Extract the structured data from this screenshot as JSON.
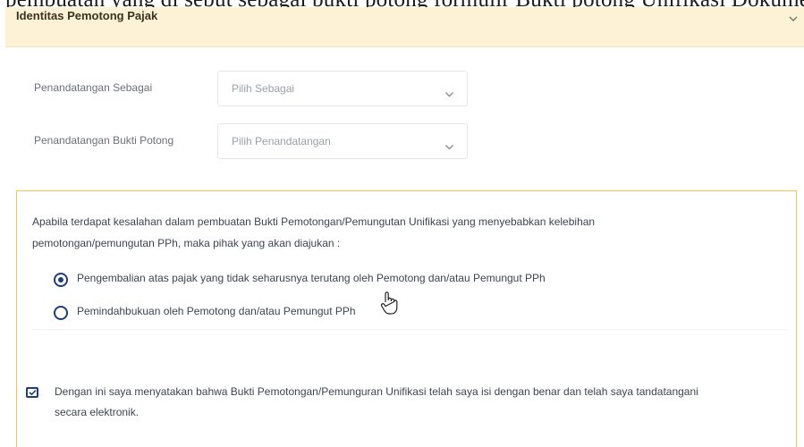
{
  "overlay_caption": "pembuatan yang di sebut sebagai bukti potong formulir Bukti potong Unifikasi Dokumen",
  "panel": {
    "title": "Identitas Pemotong Pajak",
    "collapse_icon": "chevron-down-icon"
  },
  "form": {
    "signer_as": {
      "label": "Penandatangan Sebagai",
      "value": "Pilih Sebagai"
    },
    "signer_proof": {
      "label": "Penandatangan Bukti Potong",
      "value": "Pilih Penandatangan"
    }
  },
  "notice": {
    "intro_line1": "Apabila terdapat kesalahan dalam pembuatan Bukti Pemotongan/Pemungutan Unifikasi yang menyebabkan kelebihan",
    "intro_line2": "pemotongan/pemungutan PPh, maka pihak yang akan diajukan :",
    "options": [
      {
        "label": "Pengembalian atas pajak yang tidak seharusnya terutang oleh Pemotong dan/atau Pemungut PPh",
        "selected": true
      },
      {
        "label": "Pemindahbukuan oleh Pemotong dan/atau Pemungut PPh",
        "selected": false
      }
    ],
    "confirmation_line1": "Dengan ini saya menyatakan bahwa Bukti Pemotongan/Pemunguran Unifikasi telah saya isi dengan benar dan telah saya tandatangani",
    "confirmation_line2": "secara elektronik.",
    "confirmation_checked": true
  },
  "colors": {
    "header_bg": "#fdf1d6",
    "accent_border": "#f3c15a",
    "control_blue": "#1d3e7a"
  }
}
